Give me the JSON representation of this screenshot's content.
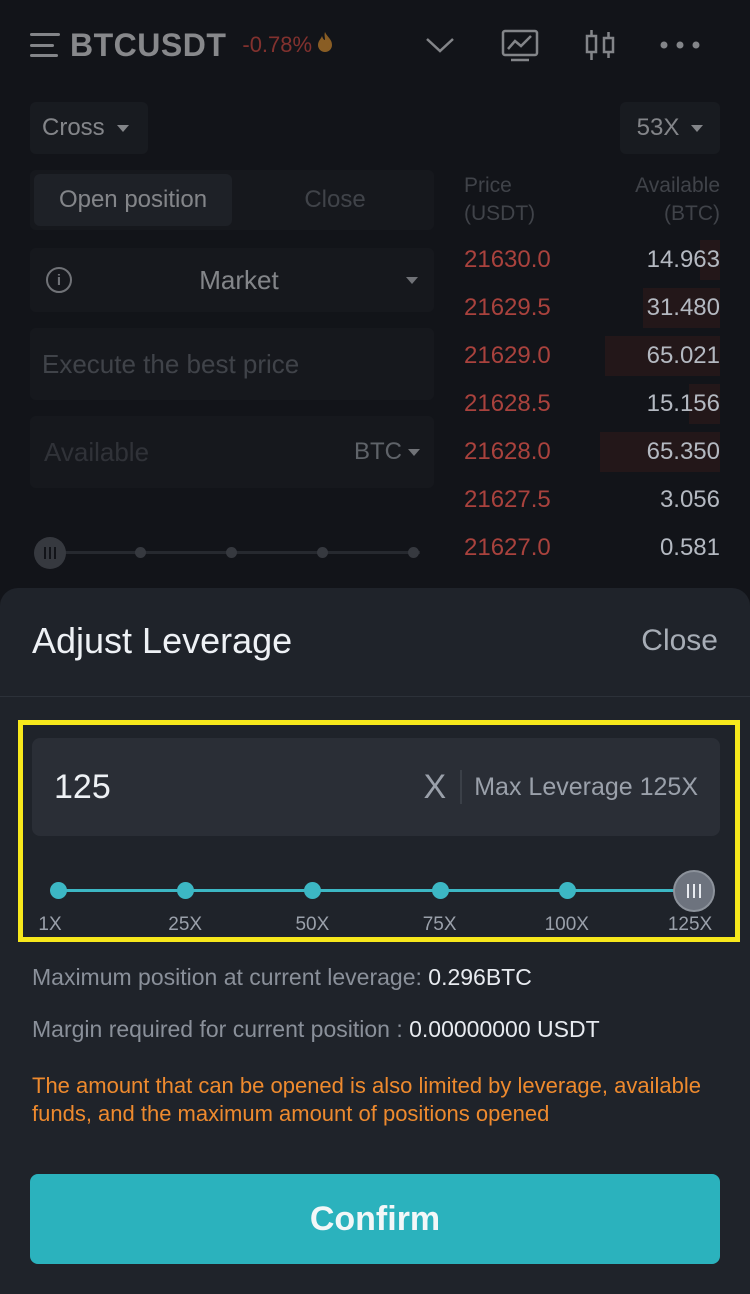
{
  "header": {
    "symbol": "BTCUSDT",
    "change": "-0.78%"
  },
  "form": {
    "margin_mode": "Cross",
    "leverage": "53X",
    "tabs": {
      "open": "Open position",
      "close": "Close"
    },
    "order_type": "Market",
    "price_placeholder": "Execute the best price",
    "available_placeholder": "Available",
    "unit": "BTC"
  },
  "orderbook": {
    "price_header": "Price\n(USDT)",
    "available_header": "Available\n(BTC)",
    "rows": [
      {
        "price": "21630.0",
        "amount": "14.963",
        "depth": 0.08
      },
      {
        "price": "21629.5",
        "amount": "31.480",
        "depth": 0.3
      },
      {
        "price": "21629.0",
        "amount": "65.021",
        "depth": 0.45
      },
      {
        "price": "21628.5",
        "amount": "15.156",
        "depth": 0.12
      },
      {
        "price": "21628.0",
        "amount": "65.350",
        "depth": 0.47
      },
      {
        "price": "21627.5",
        "amount": "3.056",
        "depth": 0.0
      },
      {
        "price": "21627.0",
        "amount": "0.581",
        "depth": 0.0
      }
    ]
  },
  "sheet": {
    "title": "Adjust Leverage",
    "close_label": "Close",
    "leverage_value": "125",
    "clear_symbol": "X",
    "max_leverage": "Max Leverage 125X",
    "slider": {
      "value": 125,
      "max": 125,
      "marks": [
        "1X",
        "25X",
        "50X",
        "75X",
        "100X",
        "125X"
      ]
    },
    "max_position_label": "Maximum position at current leverage:",
    "max_position_value": "0.296BTC",
    "margin_label": "Margin required for current position :",
    "margin_value": "0.00000000 USDT",
    "warning": "The amount that can be opened is also limited by leverage, available funds, and the maximum amount of positions opened",
    "confirm_label": "Confirm"
  },
  "colors": {
    "accent": "#2bb2bd",
    "sell": "#e5534b",
    "warning": "#ee8a2e",
    "highlight": "#f7e81c"
  }
}
